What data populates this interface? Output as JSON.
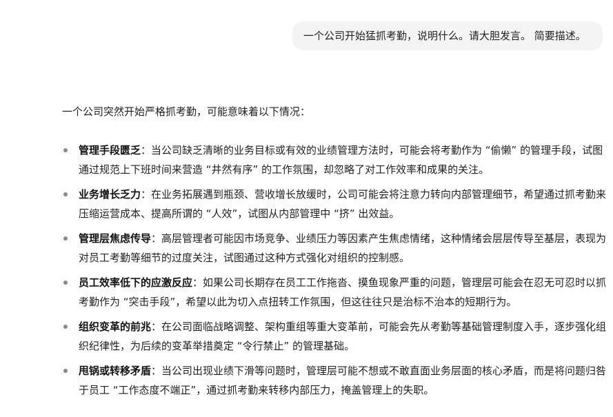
{
  "user_message": "一个公司开始猛抓考勤，说明什么。请大胆发言。 简要描述。",
  "answer": {
    "intro": "一个公司突然开始严格抓考勤，可能意味着以下情况：",
    "items": [
      {
        "title": "管理手段匮乏",
        "text": "：当公司缺乏清晰的业务目标或有效的业绩管理方法时，可能会将考勤作为 “偷懒” 的管理手段，试图通过规范上下班时间来营造 “井然有序” 的工作氛围，却忽略了对工作效率和成果的关注。"
      },
      {
        "title": "业务增长乏力",
        "text": "：在业务拓展遇到瓶颈、营收增长放缓时，公司可能会将注意力转向内部管理细节，希望通过抓考勤来压缩运营成本、提高所谓的 “人效”，试图从内部管理中 “挤” 出效益。"
      },
      {
        "title": "管理层焦虑传导",
        "text": "：高层管理者可能因市场竞争、业绩压力等因素产生焦虑情绪，这种情绪会层层传导至基层，表现为对员工考勤等细节的过度关注，试图通过这种方式强化对组织的控制感。"
      },
      {
        "title": "员工效率低下的应激反应",
        "text": "：如果公司长期存在员工工作拖沓、摸鱼现象严重的问题，管理层可能会在忍无可忍时以抓考勤作为 “突击手段”，希望以此为切入点扭转工作氛围，但这往往只是治标不治本的短期行为。"
      },
      {
        "title": "组织变革的前兆",
        "text": "：在公司面临战略调整、架构重组等重大变革前，可能会先从考勤等基础管理制度入手，逐步强化组织纪律性，为后续的变革举措奠定 “令行禁止” 的管理基础。"
      },
      {
        "title": "甩锅或转移矛盾",
        "text": "：当公司出现业绩下滑等问题时，管理层可能不想或不敢直面业务层面的核心矛盾，而是将问题归咎于员工 “工作态度不端正”，通过抓考勤来转移内部压力，掩盖管理上的失职。"
      }
    ]
  }
}
